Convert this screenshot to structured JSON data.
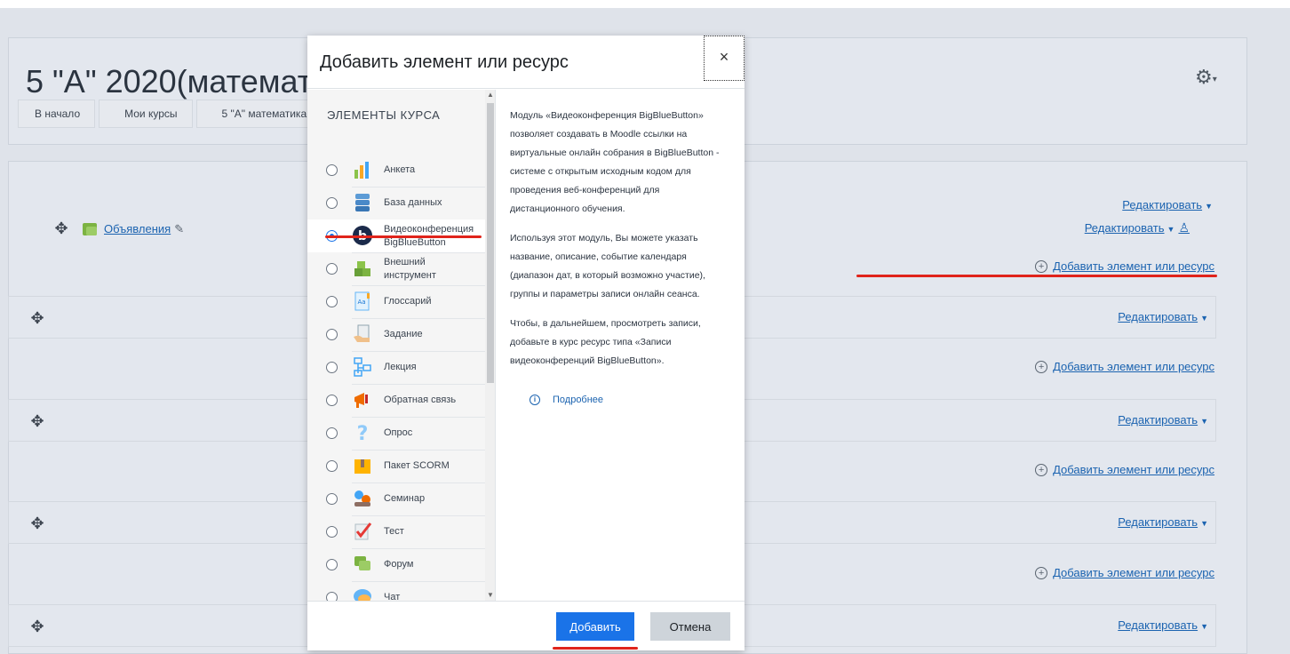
{
  "course": {
    "title": "5 \"А\" 2020(математи",
    "breadcrumb": [
      "В начало",
      "Мои курсы",
      "5 \"А\" математика"
    ]
  },
  "announcements": {
    "label": "Объявления"
  },
  "edit_label": "Редактировать",
  "add_resource_label": "Добавить элемент или ресурс",
  "modal": {
    "title": "Добавить элемент или ресурс",
    "close": "×",
    "list_heading": "ЭЛЕМЕНТЫ КУРСА",
    "items": [
      {
        "label": "Анкета",
        "icon": "survey-icon",
        "selected": false
      },
      {
        "label": "База данных",
        "icon": "database-icon",
        "selected": false
      },
      {
        "label": "Видеоконференция\nBigBlueButton",
        "icon": "bigbluebutton-icon",
        "selected": true
      },
      {
        "label": "Внешний\nинструмент",
        "icon": "external-tool-icon",
        "selected": false
      },
      {
        "label": "Глоссарий",
        "icon": "glossary-icon",
        "selected": false
      },
      {
        "label": "Задание",
        "icon": "assignment-icon",
        "selected": false
      },
      {
        "label": "Лекция",
        "icon": "lesson-icon",
        "selected": false
      },
      {
        "label": "Обратная связь",
        "icon": "feedback-icon",
        "selected": false
      },
      {
        "label": "Опрос",
        "icon": "choice-icon",
        "selected": false
      },
      {
        "label": "Пакет SCORM",
        "icon": "scorm-icon",
        "selected": false
      },
      {
        "label": "Семинар",
        "icon": "workshop-icon",
        "selected": false
      },
      {
        "label": "Тест",
        "icon": "quiz-icon",
        "selected": false
      },
      {
        "label": "Форум",
        "icon": "forum-icon",
        "selected": false
      },
      {
        "label": "Чат",
        "icon": "chat-icon",
        "selected": false
      }
    ],
    "description": [
      "Модуль «Видеоконференция BigBlueButton» позволяет создавать в Moodle ссылки на виртуальные онлайн собрания в BigBlueButton - системе с открытым исходным кодом для проведения веб-конференций для дистанционного обучения.",
      "Используя этот модуль, Вы можете указать название, описание, событие календаря (диапазон дат, в который возможно участие), группы и параметры записи онлайн сеанса.",
      "Чтобы, в дальнейшем, просмотреть записи, добавьте в курс ресурс типа «Записи видеоконференций BigBlueButton»."
    ],
    "more_link": "Подробнее",
    "add_button": "Добавить",
    "cancel_button": "Отмена"
  },
  "colors": {
    "accent": "#1a73e8",
    "link": "#1b63b0",
    "highlight": "#e0241b"
  }
}
